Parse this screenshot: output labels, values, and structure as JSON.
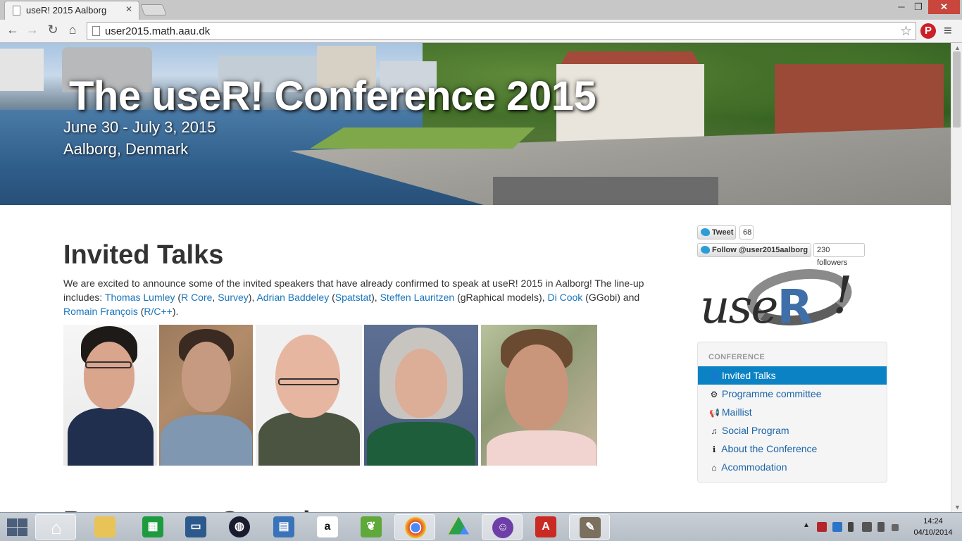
{
  "browser": {
    "tab_title": "useR! 2015 Aalborg",
    "tab_close": "✕",
    "url": "user2015.math.aau.dk",
    "win_min": "─",
    "win_max": "❐",
    "win_close": "✕",
    "icons": {
      "back": "arrow-left-icon",
      "forward": "arrow-right-icon",
      "reload": "reload-icon",
      "home": "home-icon",
      "bookmark": "star-icon",
      "extension": "pinterest-icon",
      "menu": "hamburger-menu-icon"
    }
  },
  "banner": {
    "title": "The useR! Conference 2015",
    "dates": "June 30 - July 3, 2015",
    "place": "Aalborg, Denmark"
  },
  "main": {
    "heading": "Invited Talks",
    "intro": {
      "t1": "We are excited to announce some of the invited speakers that have already confirmed to speak at useR! 2015 in Aalborg! The line-up includes: ",
      "thomas": "Thomas Lumley",
      "t2": " (",
      "rcore": "R Core",
      "t3": ", ",
      "survey": "Survey",
      "t4": "), ",
      "adrian": "Adrian Baddeley",
      "t5": " (",
      "spatstat": "Spatstat",
      "t6": "), ",
      "steffen": "Steffen Lauritzen",
      "t7": " (gRaphical models), ",
      "di": "Di Cook",
      "t8": " (GGobi) and ",
      "romain": "Romain François",
      "t9": " (",
      "rcpp": "R/C++",
      "t10": ")."
    },
    "next_heading": "Programme Committee"
  },
  "sidebar": {
    "tweet_label": "Tweet",
    "tweet_count": "68",
    "follow_label": "Follow @user2015aalborg",
    "follow_count": "230 followers",
    "logo_text": "use",
    "logo_r": "R",
    "logo_bang": "!",
    "nav_header": "CONFERENCE",
    "nav_items": [
      {
        "label": "Invited Talks",
        "icon": "user-icon",
        "glyph": "👤"
      },
      {
        "label": "Programme committee",
        "icon": "gear-icon",
        "glyph": "⚙"
      },
      {
        "label": "Maillist",
        "icon": "megaphone-icon",
        "glyph": "📢"
      },
      {
        "label": "Social Program",
        "icon": "music-note-icon",
        "glyph": "♫"
      },
      {
        "label": "About the Conference",
        "icon": "info-icon",
        "glyph": "ℹ"
      },
      {
        "label": "Acommodation",
        "icon": "home-icon",
        "glyph": "⌂"
      }
    ],
    "active_index": 0
  },
  "taskbar": {
    "apps": [
      "home",
      "file-explorer",
      "store",
      "remote-desktop",
      "app-launcher",
      "messaging",
      "amazon",
      "evernote",
      "chrome",
      "google-drive",
      "github",
      "acrobat",
      "gimp"
    ],
    "clock_time": "14:24",
    "clock_date": "04/10/2014"
  },
  "colors": {
    "link": "#1a75bc",
    "nav_active": "#0b82c4",
    "close_button": "#c9463d",
    "twitter": "#2b9ed8"
  }
}
